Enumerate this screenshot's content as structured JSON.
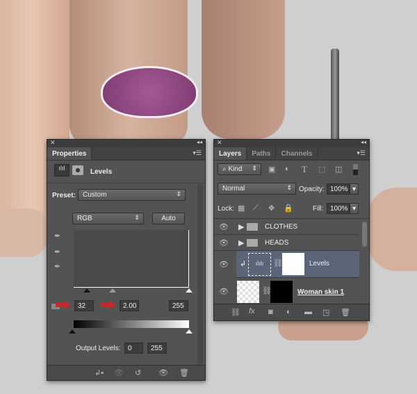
{
  "properties": {
    "tab": "Properties",
    "title": "Levels",
    "preset_label": "Preset:",
    "preset_value": "Custom",
    "channel_value": "RGB",
    "auto_label": "Auto",
    "input_black": "32",
    "input_gamma": "2.00",
    "input_white": "255",
    "output_label": "Output Levels:",
    "output_black": "0",
    "output_white": "255"
  },
  "layers": {
    "tabs": [
      "Layers",
      "Paths",
      "Channels"
    ],
    "filter_value": "Kind",
    "blend_mode": "Normal",
    "opacity_label": "Opacity:",
    "opacity_value": "100%",
    "lock_label": "Lock:",
    "fill_label": "Fill:",
    "fill_value": "100%",
    "items": [
      {
        "name": "CLOTHES",
        "type": "group"
      },
      {
        "name": "HEADS",
        "type": "group"
      },
      {
        "name": "Levels",
        "type": "adjustment",
        "selected": true
      },
      {
        "name": "Woman skin 1",
        "type": "pixel"
      }
    ]
  },
  "colors": {
    "arrow": "#c8282a",
    "selected_layer": "#5a6678"
  }
}
